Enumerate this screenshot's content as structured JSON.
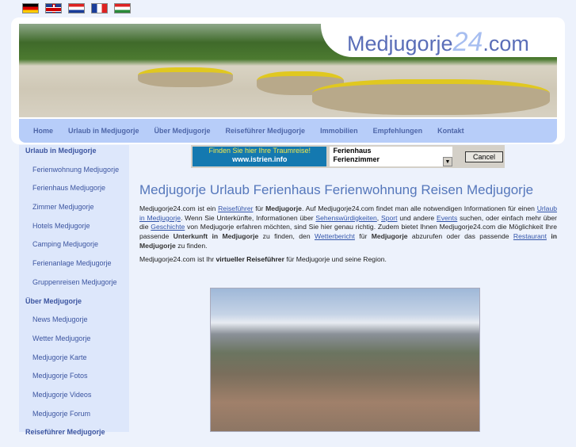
{
  "flags": [
    "de",
    "en",
    "hr",
    "fr",
    "hu"
  ],
  "logo": {
    "pre": "Medjugorje",
    "num": "24",
    "post": ".com"
  },
  "nav": [
    "Home",
    "Urlaub in Medjugorje",
    "Über Medjugorje",
    "Reiseführer Medjugorje",
    "Immobilien",
    "Empfehlungen",
    "Kontakt"
  ],
  "sidebar": [
    {
      "t": "h",
      "label": "Urlaub in Medjugorje"
    },
    {
      "t": "s",
      "label": "Ferienwohnung Medjugorje"
    },
    {
      "t": "s",
      "label": "Ferienhaus Medjugorje"
    },
    {
      "t": "s",
      "label": "Zimmer Medjugorje"
    },
    {
      "t": "s",
      "label": "Hotels Medjugorje"
    },
    {
      "t": "s",
      "label": "Camping Medjugorje"
    },
    {
      "t": "s",
      "label": "Ferienanlage Medjugorje"
    },
    {
      "t": "s",
      "label": "Gruppenreisen Medjugorje"
    },
    {
      "t": "h",
      "label": "Über Medjugorje"
    },
    {
      "t": "s",
      "label": "News Medjugorje"
    },
    {
      "t": "s",
      "label": "Wetter Medjugorje"
    },
    {
      "t": "s",
      "label": "Medjugorje Karte"
    },
    {
      "t": "s",
      "label": "Medjugorje Fotos"
    },
    {
      "t": "s",
      "label": "Medjugorje Videos"
    },
    {
      "t": "s",
      "label": "Medjugorje Forum"
    },
    {
      "t": "h",
      "label": "Reiseführer Medjugorje"
    }
  ],
  "banner": {
    "line1": "Finden Sie hier Ihre Traumreise!",
    "line2": "www.istrien.info",
    "options": [
      "Ferienhaus",
      "Ferienzimmer"
    ],
    "cancel": "Cancel"
  },
  "heading": "Medjugorje Urlaub Ferienhaus Ferienwohnung Reisen Medjugorje",
  "p2": {
    "a": "Medjugorje24.com ist Ihr ",
    "b": "virtueller Reiseführer",
    "c": " für Medjugorje und seine Region."
  }
}
